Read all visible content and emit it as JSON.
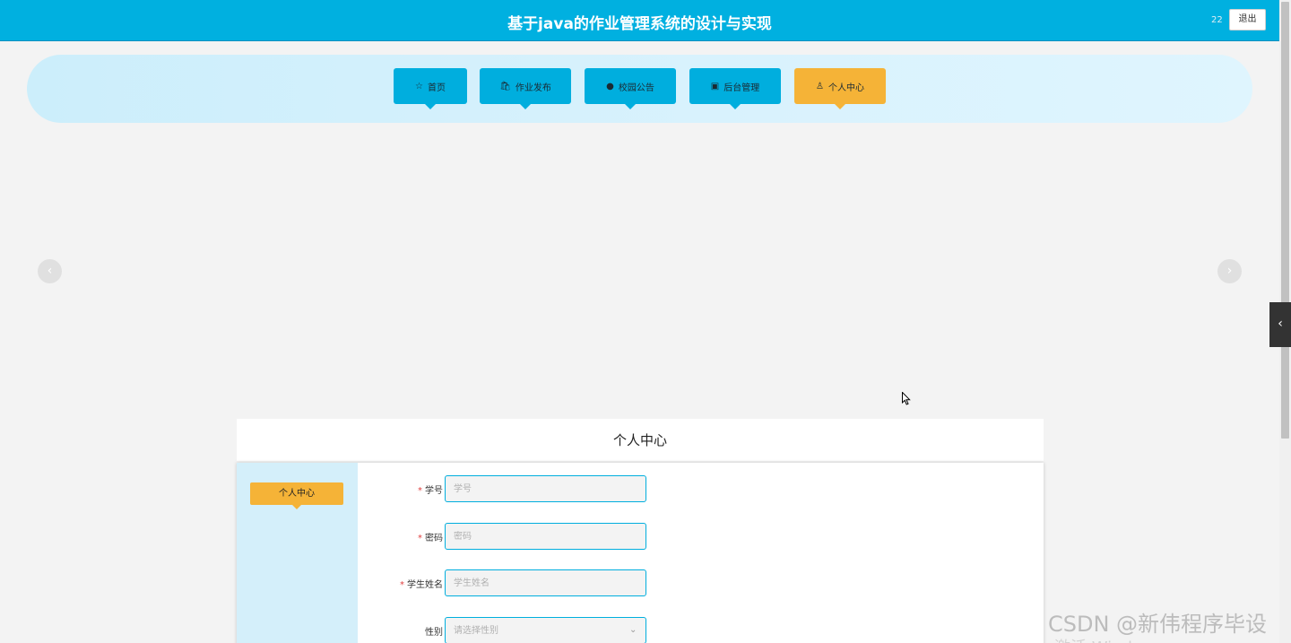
{
  "header": {
    "title": "基于java的作业管理系统的设计与实现",
    "user": "22",
    "logout_label": "退出"
  },
  "nav": {
    "items": [
      {
        "label": "首页",
        "icon": "star-icon"
      },
      {
        "label": "作业发布",
        "icon": "bag-icon"
      },
      {
        "label": "校园公告",
        "icon": "info-icon"
      },
      {
        "label": "后台管理",
        "icon": "briefcase-icon"
      },
      {
        "label": "个人中心",
        "icon": "user-icon",
        "active": true
      }
    ]
  },
  "carousel": {
    "prev_icon": "chevron-left-icon",
    "next_icon": "chevron-right-icon"
  },
  "page": {
    "heading": "个人中心",
    "side_menu_label": "个人中心"
  },
  "form": {
    "fields": [
      {
        "label": "学号",
        "required": true,
        "placeholder": "学号",
        "value": ""
      },
      {
        "label": "密码",
        "required": true,
        "placeholder": "密码",
        "value": ""
      },
      {
        "label": "学生姓名",
        "required": true,
        "placeholder": "学生姓名",
        "value": ""
      },
      {
        "label": "性别",
        "required": false,
        "placeholder": "请选择性别",
        "value": ""
      }
    ]
  },
  "watermark": {
    "text": "CSDN @新伟程序毕设",
    "text2": "激活 Windows"
  },
  "colors": {
    "primary": "#00aede",
    "active": "#f5b337",
    "required": "#e04040"
  }
}
